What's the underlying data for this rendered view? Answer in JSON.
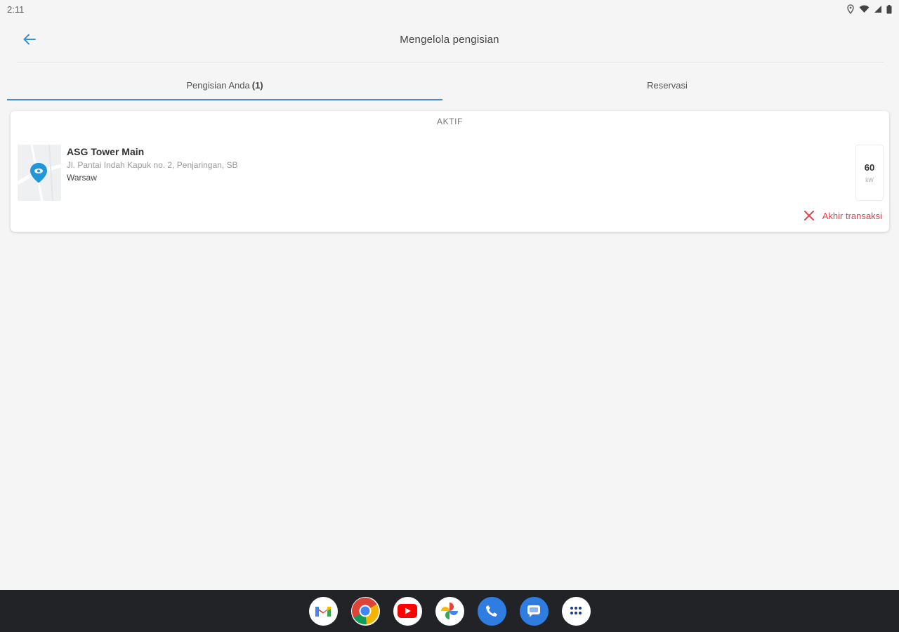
{
  "status_bar": {
    "time": "2:11",
    "icons": [
      "location-icon",
      "wifi-icon",
      "signal-icon",
      "battery-icon"
    ]
  },
  "app_bar": {
    "back_icon": "arrow-back-icon",
    "title": "Mengelola pengisian"
  },
  "tabs": [
    {
      "label": "Pengisian Anda",
      "count": "(1)",
      "active": true
    },
    {
      "label": "Reservasi",
      "active": false
    }
  ],
  "card": {
    "header": "AKTIF",
    "station_name": "ASG Tower Main",
    "address": "Jl. Pantai Indah Kapuk no. 2, Penjaringan, SB",
    "city": "Warsaw",
    "power_value": "60",
    "power_unit": "kW",
    "end_label": "Akhir transaksi",
    "end_icon": "close-icon"
  },
  "dock": [
    "gmail-icon",
    "chrome-icon",
    "youtube-icon",
    "photos-icon",
    "phone-icon",
    "messages-icon",
    "apps-grid-icon"
  ],
  "colors": {
    "accent": "#3b8fd6",
    "danger": "#e0444e",
    "background": "#f5f5f5",
    "nav_bar": "#222327"
  }
}
